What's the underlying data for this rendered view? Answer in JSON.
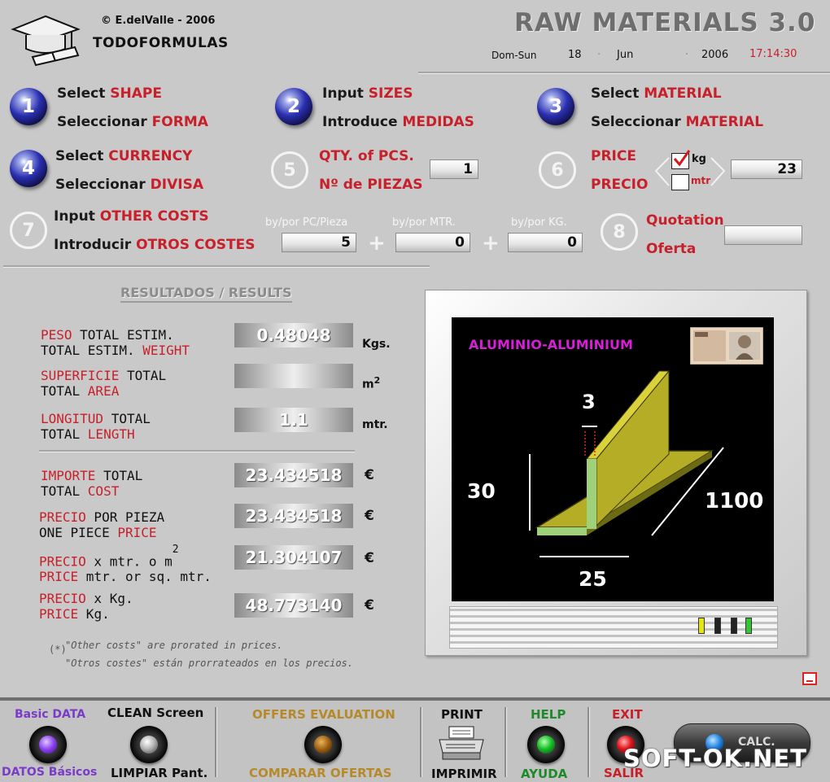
{
  "header": {
    "copyright": "© E.delValle - 2006",
    "brand": "TODOFORMULAS",
    "app_title": "RAW MATERIALS 3.0",
    "date": {
      "day": "Dom-Sun",
      "dd": "18",
      "sep1": "·",
      "month": "Jun",
      "sep2": "·",
      "year": "2006",
      "time": "17:14:30"
    }
  },
  "steps": {
    "s1": {
      "num": "1",
      "en_a": "Select ",
      "en_b": "SHAPE",
      "es_a": "Seleccionar ",
      "es_b": "FORMA"
    },
    "s2": {
      "num": "2",
      "en_a": "Input ",
      "en_b": "SIZES",
      "es_a": "Introduce ",
      "es_b": "MEDIDAS"
    },
    "s3": {
      "num": "3",
      "en_a": "Select ",
      "en_b": "MATERIAL",
      "es_a": "Seleccionar ",
      "es_b": "MATERIAL"
    },
    "s4": {
      "num": "4",
      "en_a": "Select ",
      "en_b": "CURRENCY",
      "es_a": "Seleccionar ",
      "es_b": "DIVISA"
    },
    "s5": {
      "num": "5",
      "en": "QTY. of PCS.",
      "es": "Nº de PIEZAS",
      "value": "1"
    },
    "s6": {
      "num": "6",
      "en": "PRICE",
      "es": "PRECIO",
      "unit_kg": "kg",
      "unit_mtr": "mtr",
      "value": "23"
    },
    "s7": {
      "num": "7",
      "en_a": "Input ",
      "en_b": "OTHER COSTS",
      "es_a": "Introducir ",
      "es_b": "OTROS COSTES",
      "hint_pc": "by/por PC/Pieza",
      "hint_mtr": "by/por MTR.",
      "hint_kg": "by/por KG.",
      "val_pc": "5",
      "val_mtr": "0",
      "val_kg": "0",
      "plus": "+"
    },
    "s8": {
      "num": "8",
      "en": "Quotation",
      "es": "Oferta",
      "value": ""
    }
  },
  "results": {
    "title": "RESULTADOS / RESULTS",
    "weight": {
      "l1a": "PESO",
      "l1b": " TOTAL ESTIM.",
      "l2a": "TOTAL ESTIM. ",
      "l2b": "WEIGHT",
      "value": "0.48048",
      "unit": "Kgs."
    },
    "area": {
      "l1a": "SUPERFICIE",
      "l1b": " TOTAL",
      "l2a": "TOTAL ",
      "l2b": "AREA",
      "value": "",
      "unit": "m",
      "unit_sup": "2"
    },
    "length": {
      "l1a": "LONGITUD",
      "l1b": " TOTAL",
      "l2a": "TOTAL ",
      "l2b": "LENGTH",
      "value": "1.1",
      "unit": "mtr."
    },
    "cost": {
      "l1a": "IMPORTE",
      "l1b": " TOTAL",
      "l2a": "TOTAL ",
      "l2b": "COST",
      "value": "23.434518",
      "unit": "€"
    },
    "piece": {
      "l1a": "PRECIO",
      "l1b": "  POR PIEZA",
      "l2a": "ONE PIECE ",
      "l2b": "PRICE",
      "value": "23.434518",
      "unit": "€"
    },
    "permtr": {
      "l1a": "PRECIO",
      "l1b": " x mtr. o m",
      "sup": "2",
      "l2a": "PRICE",
      "l2b": " mtr. or sq. mtr.",
      "value": "21.304107",
      "unit": "€"
    },
    "perkg": {
      "l1a": "PRECIO",
      "l1b": " x Kg.",
      "l2a": "PRICE",
      "l2b": " Kg.",
      "value": "48.773140",
      "unit": "€"
    },
    "note_mark": "(*)",
    "note_en": "\"Other costs\" are prorated in prices.",
    "note_es": "\"Otros costes\" están prorrateados en los precios."
  },
  "monitor": {
    "material": "ALUMINIO-ALUMINIUM",
    "dim_thickness": "3",
    "dim_height": "30",
    "dim_length": "1100",
    "dim_width": "25",
    "colors": {
      "material_text": "#d61fd6",
      "profile": "#b5ad26",
      "profile_dark": "#6d6a14",
      "section": "#9fd07a"
    }
  },
  "bottom": {
    "basic_en": "Basic DATA",
    "basic_es": "DATOS Básicos",
    "clean_en": "CLEAN Screen",
    "clean_es": "LIMPIAR Pant.",
    "offers_en": "OFFERS EVALUATION",
    "offers_es": "COMPARAR OFERTAS",
    "print_en": "PRINT",
    "print_es": "IMPRIMIR",
    "help_en": "HELP",
    "help_es": "AYUDA",
    "exit_en": "EXIT",
    "exit_es": "SALIR",
    "calc": "CALC.",
    "watermark": "SOFT-OK.NET"
  }
}
